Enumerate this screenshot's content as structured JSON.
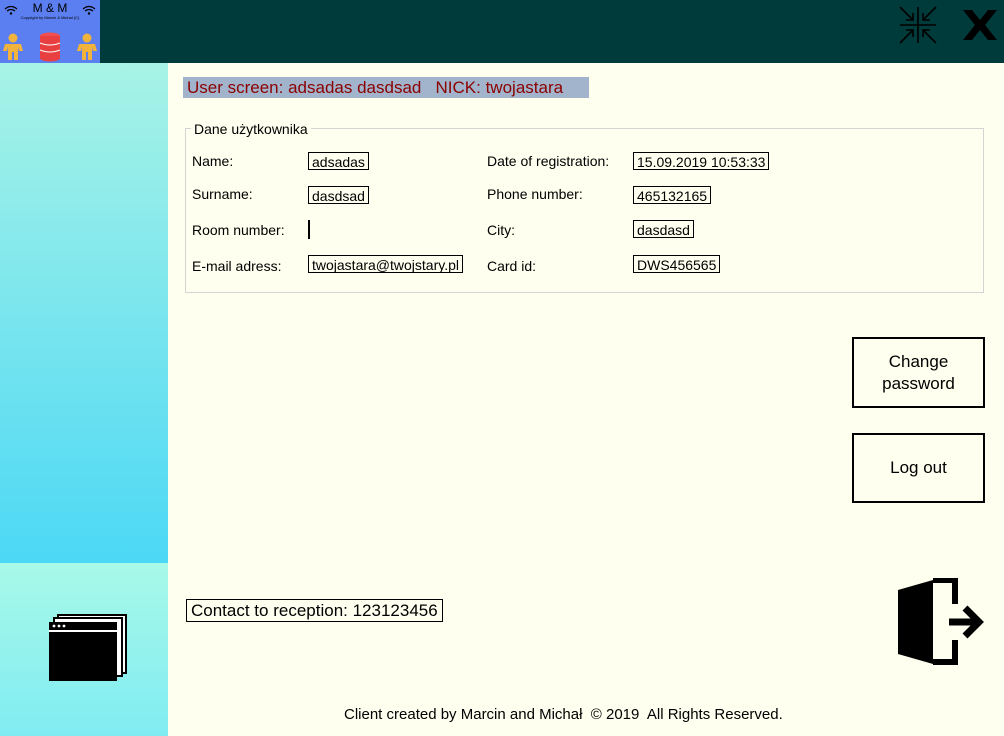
{
  "app": {
    "logo_title": "M & M",
    "logo_copyright": "Copyright by Marcin & Michał (C)"
  },
  "header": {
    "user_screen": "User screen: adsadas dasdsad   NICK: twojastara"
  },
  "user_details": {
    "group_title": "Dane użytkownika",
    "name_label": "Name:",
    "name_value": "adsadas",
    "surname_label": "Surname:",
    "surname_value": "dasdsad",
    "room_label": "Room number:",
    "room_value": "",
    "email_label": "E-mail adress:",
    "email_value": "twojastara@twojstary.pl",
    "registration_label": "Date of registration:",
    "registration_value": "15.09.2019 10:53:33",
    "phone_label": "Phone number:",
    "phone_value": "465132165",
    "city_label": "City:",
    "city_value": "dasdasd",
    "card_label": "Card id:",
    "card_value": "DWS456565"
  },
  "actions": {
    "change_password_line1": "Change",
    "change_password_line2": "password",
    "logout_label": "Log out"
  },
  "contact": {
    "text": "Contact to reception: 123123456"
  },
  "footer": {
    "text": "Client created by Marcin and Michał  © 2019  All Rights Reserved."
  },
  "icons": {
    "minimize": "compress-icon",
    "close": "close-x-icon",
    "windows": "windows-stack-icon",
    "exit": "exit-door-icon"
  },
  "colors": {
    "topbar": "#003b3b",
    "logo_bg": "#5b7ff0",
    "header_bg": "#a1b4cc",
    "header_text": "#8b0000",
    "content_bg": "#fffff0"
  }
}
